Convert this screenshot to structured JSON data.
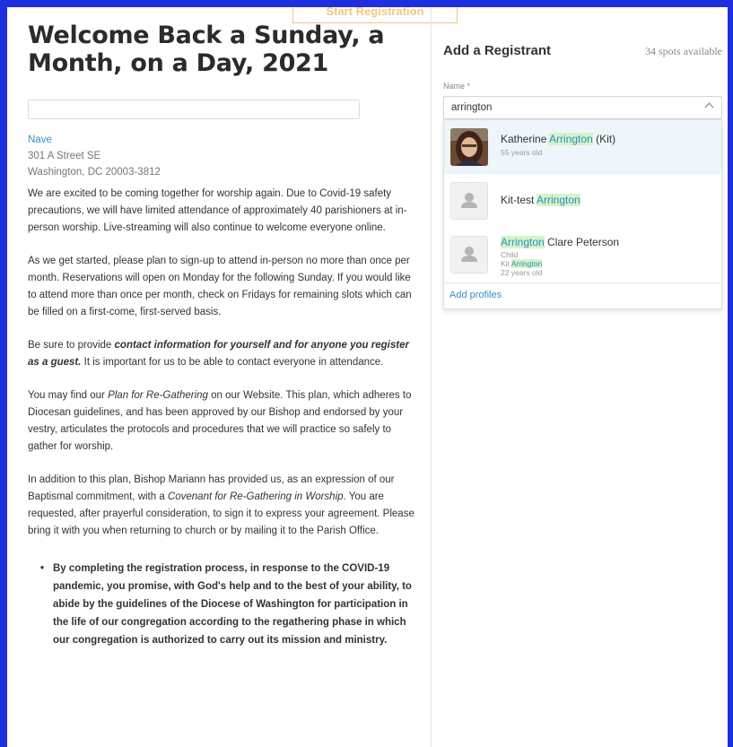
{
  "top_button": {
    "label": "Start Registration"
  },
  "event": {
    "title": "Welcome Back a Sunday, a Month, on a Day, 2021",
    "venue_name": "Nave",
    "address_line1": "301 A Street SE",
    "address_line2": "Washington, DC 20003-3812"
  },
  "body": {
    "p1": "We are excited to be coming together for worship again.  Due to Covid-19 safety precautions, we will have limited attendance of approximately 40 parishioners at in-person worship.  Live-streaming will also continue to welcome everyone online.",
    "p2": "As we get started, please plan to sign-up to attend in-person no more than once per month.  Reservations will open on Monday for the following Sunday.  If you would like to attend more than once per month, check on Fridays for remaining slots which can be filled on a first-come, first-served basis.",
    "p3_pre": "Be sure to provide ",
    "p3_strong": "contact information for yourself and for anyone you register as a guest.",
    "p3_post": "  It is important for us to be able to contact everyone in attendance.",
    "p4_pre": "You may find our ",
    "p4_em": "Plan for Re-Gathering",
    "p4_post": " on our Website.  This plan, which adheres to Diocesan guidelines, and has been approved by our Bishop and endorsed by your vestry, articulates the protocols and procedures that we will practice so safely to gather for worship.",
    "p5_pre": "In addition to this plan, Bishop Mariann has provided us, as an expression of our Baptismal commitment, with a ",
    "p5_em": "Covenant for Re-Gathering in Worship",
    "p5_post": ".  You are requested, after prayerful consideration, to sign it to express your agreement.  Please bring it with you when returning to church or by mailing it to the Parish Office.",
    "bullet1": "By completing the registration process, in response to the COVID-19 pandemic, you promise, with God's help and to the best of your ability, to abide by the guidelines of the Diocese of Washington for participation in the life of our congregation according to the regathering phase in which our congregation is authorized to carry out its mission and ministry."
  },
  "registrant": {
    "title": "Add a Registrant",
    "spots": "34 spots available",
    "name_label": "Name *",
    "search_value": "arrington",
    "options": [
      {
        "name_pre": "Katherine ",
        "name_hl": "Arrington",
        "name_post": " (Kit)",
        "sub1": "55 years old"
      },
      {
        "name_pre": "Kit-test ",
        "name_hl": "Arrington",
        "name_post": ""
      },
      {
        "name_hl": "Arrington",
        "name_post": " Clare Peterson",
        "sub1": "Child",
        "sub2_pre": "Kit ",
        "sub2_hl": "Arrington",
        "sub3": "22 years old"
      }
    ],
    "add_profiles": "Add profiles"
  },
  "colors": {
    "background": "#1f2fe0",
    "link": "#3a8fc4",
    "highlight": "#d6f3c9",
    "accent_button": "#f0b45a"
  }
}
